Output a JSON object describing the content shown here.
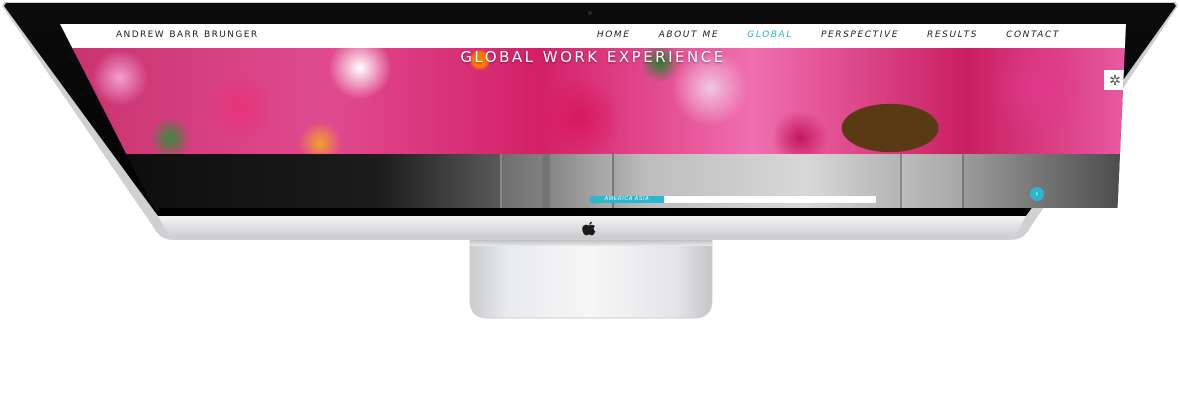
{
  "site": {
    "brand": "ANDREW BARR BRUNGER",
    "nav": [
      {
        "label": "HOME",
        "active": false
      },
      {
        "label": "ABOUT ME",
        "active": false
      },
      {
        "label": "GLOBAL",
        "active": true
      },
      {
        "label": "PERSPECTIVE",
        "active": false
      },
      {
        "label": "RESULTS",
        "active": false
      },
      {
        "label": "CONTACT",
        "active": false
      }
    ],
    "hero_title": "GLOBAL WORK EXPERIENCE",
    "progress_label": "AMERICA ASIA",
    "accent_color": "#2bb6d1"
  },
  "icons": {
    "settings": "gear-icon",
    "scroll": "arrow-icon",
    "device_logo": "apple-logo-icon"
  }
}
